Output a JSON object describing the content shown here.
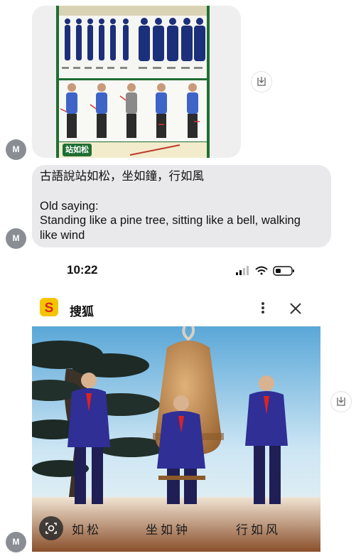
{
  "avatars": {
    "initial": "M"
  },
  "poster": {
    "footer_label": "站如松"
  },
  "message_text": {
    "line1": "古語說站如松，坐如鐘，行如風",
    "line2": "Old saying:",
    "line3": "Standing like a pine tree, sitting like a bell, walking",
    "line4": "like wind"
  },
  "phone": {
    "time": "10:22",
    "app_name": "搜狐",
    "logo_letter": "S",
    "captions": [
      "如松",
      "坐如钟",
      "行如风"
    ]
  },
  "icons": {
    "save": "save-to-device-icon",
    "more": "more-vertical-icon",
    "close": "close-icon",
    "lens": "visual-lookup-icon",
    "signal": "cellular-signal-icon",
    "wifi": "wifi-icon",
    "battery": "battery-icon"
  },
  "colors": {
    "bubble": "#e9e9eb",
    "avatar": "#8a8e94",
    "poster_green": "#1f6e33",
    "suit_blue": "#2f2f96"
  }
}
